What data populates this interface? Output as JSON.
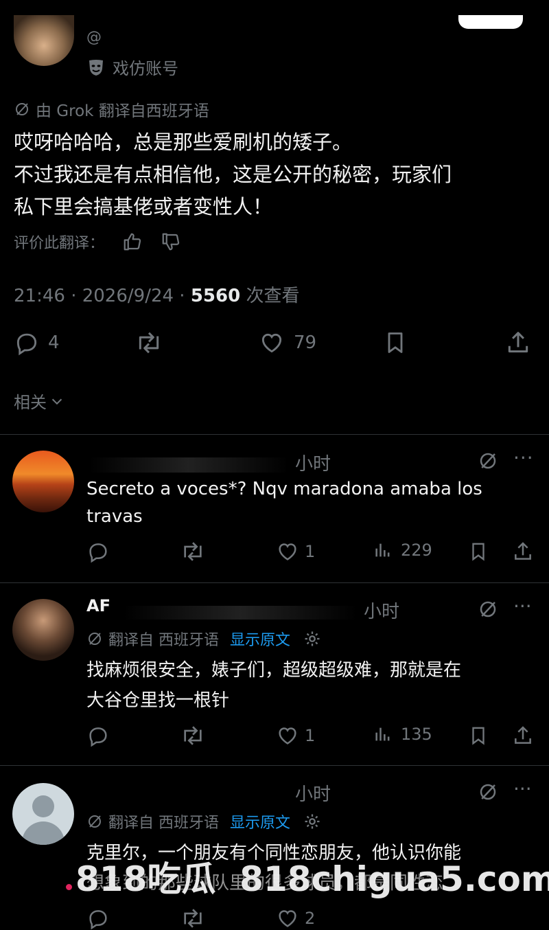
{
  "main_post": {
    "handle": "@",
    "account_label": "戏仿账号",
    "translated_by": "由 Grok 翻译自西班牙语",
    "text_line1": "哎呀哈哈哈，总是那些爱刷机的矮子。",
    "text_line2": "不过我还是有点相信他，这是公开的秘密，玩家们",
    "text_line3": "私下里会搞基佬或者变性人！",
    "rate_translation": "评价此翻译：",
    "time": "21:46 · 2026/9/24 · ",
    "views": "5560",
    "views_label": " 次查看",
    "reply_count": "4",
    "like_count": "79",
    "related": "相关"
  },
  "replies": [
    {
      "time_suffix": "小时",
      "text_line1": "Secreto a voces*? Nqv maradona amaba los",
      "text_line2": "travas",
      "like_count": "1",
      "view_count": "229"
    },
    {
      "name_fragment": "AF",
      "time_suffix": "小时",
      "translated_from": "翻译自 西班牙语",
      "show_original": "显示原文",
      "text_line1": "找麻烦很安全，婊子们，超级超级难，那就是在",
      "text_line2": "大谷仓里找一根针",
      "like_count": "1",
      "view_count": "135"
    },
    {
      "time_suffix": "小时",
      "translated_from": "翻译自 西班牙语",
      "show_original": "显示原文",
      "text_line1": "克里尔，一个朋友有个同性恋朋友，他认识你能",
      "text_line2": "想象到的那些球队里的很多球员，都是同性恋",
      "like_count": "2"
    }
  ],
  "watermark": "818吃瓜  818chigua5.com",
  "colors": {
    "background": "#000000",
    "text": "#e7e9ea",
    "muted": "#71767b",
    "link": "#1d9bf0",
    "divider": "#2f3336"
  }
}
